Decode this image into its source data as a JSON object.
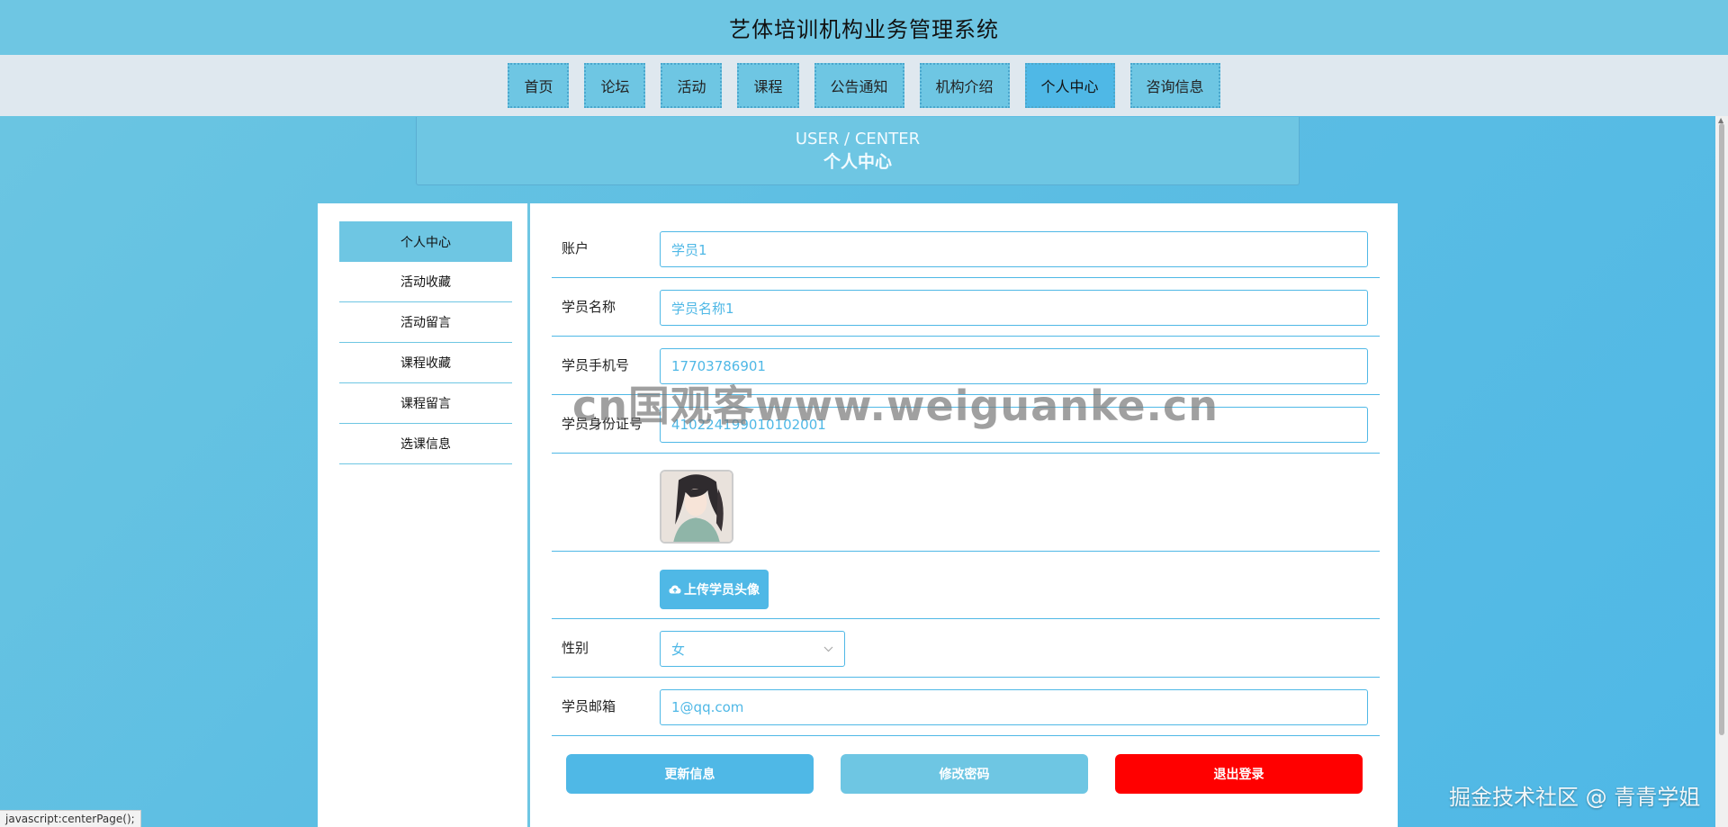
{
  "header": {
    "title": "艺体培训机构业务管理系统"
  },
  "nav": {
    "items": [
      {
        "label": "首页",
        "active": false
      },
      {
        "label": "论坛",
        "active": false
      },
      {
        "label": "活动",
        "active": false
      },
      {
        "label": "课程",
        "active": false
      },
      {
        "label": "公告通知",
        "active": false
      },
      {
        "label": "机构介绍",
        "active": false
      },
      {
        "label": "个人中心",
        "active": true
      },
      {
        "label": "咨询信息",
        "active": false
      }
    ]
  },
  "banner": {
    "en": "USER / CENTER",
    "cn": "个人中心"
  },
  "sidebar": {
    "items": [
      {
        "label": "个人中心",
        "active": true
      },
      {
        "label": "活动收藏",
        "active": false
      },
      {
        "label": "活动留言",
        "active": false
      },
      {
        "label": "课程收藏",
        "active": false
      },
      {
        "label": "课程留言",
        "active": false
      },
      {
        "label": "选课信息",
        "active": false
      }
    ]
  },
  "form": {
    "account": {
      "label": "账户",
      "value": "学员1"
    },
    "name": {
      "label": "学员名称",
      "value": "学员名称1"
    },
    "phone": {
      "label": "学员手机号",
      "value": "17703786901"
    },
    "idcard": {
      "label": "学员身份证号",
      "value": "410224199010102001"
    },
    "upload_label": "上传学员头像",
    "gender": {
      "label": "性别",
      "value": "女"
    },
    "email": {
      "label": "学员邮箱",
      "value": "1@qq.com"
    }
  },
  "buttons": {
    "update": {
      "label": "更新信息",
      "color": "#4fb8e6"
    },
    "change_password": {
      "label": "修改密码",
      "color": "#6ec6e3"
    },
    "logout": {
      "label": "退出登录",
      "color": "#ff0000"
    }
  },
  "watermarks": {
    "center": "cn国观客www.weiguanke.cn",
    "corner": "掘金技术社区 @ 青青学姐"
  },
  "statusbar": {
    "text": "javascript:centerPage();"
  },
  "colors": {
    "primary": "#4fb8e6",
    "light": "#6ec6e3",
    "nav_bg": "#dfe8ef",
    "danger": "#ff0000"
  },
  "icons": {
    "upload": "cloud-upload-icon",
    "select": "chevron-down-icon"
  }
}
